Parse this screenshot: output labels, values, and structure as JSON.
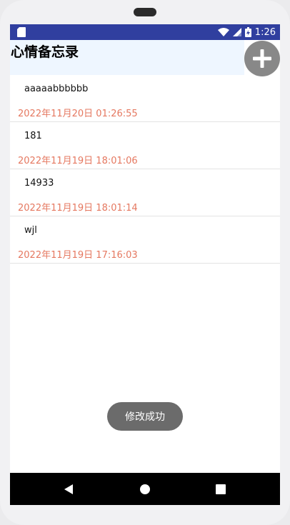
{
  "status_bar": {
    "time": "1:26",
    "icons": [
      "sd-card-icon",
      "wifi-icon",
      "signal-icon",
      "battery-icon"
    ],
    "color": "#303f9f"
  },
  "header": {
    "title": "心情备忘录",
    "add_button_icon": "plus-icon"
  },
  "memos": [
    {
      "text": "aaaaabbbbbb",
      "date": "2022年11月20日 01:26:55"
    },
    {
      "text": "181",
      "date": "2022年11月19日 18:01:06"
    },
    {
      "text": "14933",
      "date": "2022年11月19日 18:01:14"
    },
    {
      "text": "wjl",
      "date": "2022年11月19日 17:16:03"
    }
  ],
  "toast": {
    "message": "修改成功"
  },
  "nav_bar": {
    "buttons": [
      "back-icon",
      "home-icon",
      "recents-icon"
    ]
  }
}
